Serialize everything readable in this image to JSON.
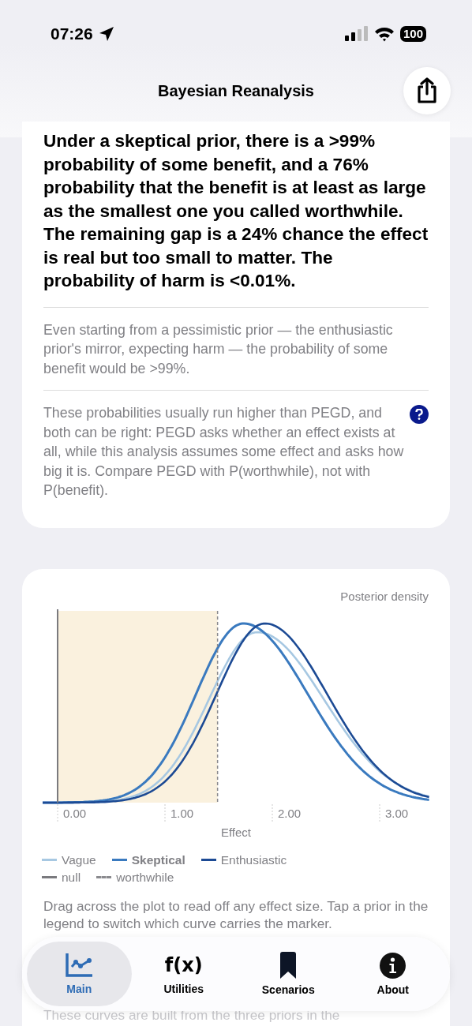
{
  "status_bar": {
    "time": "07:26",
    "battery": "100"
  },
  "header": {
    "title": "Bayesian Reanalysis"
  },
  "summary": {
    "headline": "Under a skeptical prior, there is a >99% probability of some benefit, and a 76% probability that the benefit is at least as large as the smallest one you called worthwhile. The remaining gap is a 24% chance the effect is real but too small to matter. The probability of harm is <0.01%.",
    "notes": [
      "Even starting from a pessimistic prior — the enthusiastic prior's mirror, expecting harm — the probability of some benefit would be >99%.",
      "These probabilities usually run higher than PEGD, and both can be right: PEGD asks whether an effect exists at all, while this analysis assumes some effect and asks how big it is. Compare PEGD with P(worthwhile), not with P(benefit)."
    ]
  },
  "chart": {
    "ylabel": "Posterior density",
    "xlabel": "Effect",
    "xticks": [
      "0.00",
      "1.00",
      "2.00",
      "3.00"
    ],
    "legend": [
      {
        "kind": "prior",
        "label": "Vague",
        "color": "#a7c8e2",
        "selected": false
      },
      {
        "kind": "prior",
        "label": "Skeptical",
        "color": "#3a7abf",
        "selected": true
      },
      {
        "kind": "prior",
        "label": "Enthusiastic",
        "color": "#1c4a94",
        "selected": false
      },
      {
        "kind": "solid",
        "label": "null",
        "color": "#7a7a7e"
      },
      {
        "kind": "dashed",
        "label": "worthwhile",
        "color": "#8a8a8e"
      }
    ],
    "hint": "Drag across the plot to read off any effect size. Tap a prior in the legend to switch which curve carries the marker.",
    "footer": "These curves are built from the three priors in the"
  },
  "tabs": [
    {
      "label": "Main",
      "kind": "chart",
      "selected": true
    },
    {
      "label": "Utilities",
      "kind": "fx",
      "glyph": "f(x)",
      "selected": false
    },
    {
      "label": "Scenarios",
      "kind": "bookmark",
      "selected": false
    },
    {
      "label": "About",
      "kind": "info",
      "selected": false
    }
  ]
}
